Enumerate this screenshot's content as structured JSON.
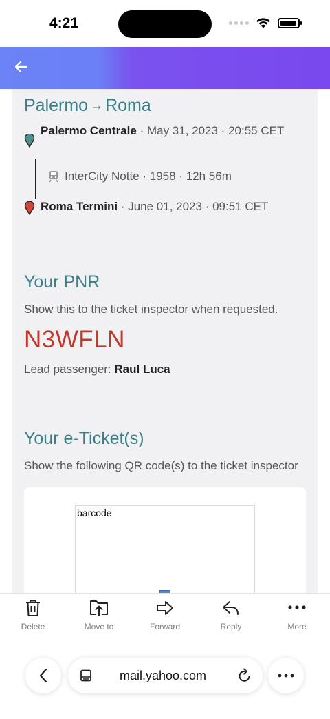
{
  "status_bar": {
    "time": "4:21"
  },
  "trip": {
    "origin_city": "Palermo",
    "arrow": "→",
    "destination_city": "Roma",
    "departure": {
      "station": "Palermo Centrale",
      "details": " · May 31, 2023 · 20:55 CET"
    },
    "train": {
      "service": "InterCity Notte",
      "number": "1958",
      "duration": "12h 56m",
      "sep": " · "
    },
    "arrival": {
      "station": "Roma Termini",
      "details": " · June 01, 2023 · 09:51 CET"
    }
  },
  "pnr": {
    "heading": "Your PNR",
    "instruction": "Show this to the ticket inspector when requested.",
    "code": "N3WFLN",
    "lead_label": "Lead passenger: ",
    "lead_name": "Raul Luca"
  },
  "eticket": {
    "heading": "Your e-Ticket(s)",
    "instruction": "Show the following QR code(s) to the ticket inspector",
    "barcode_alt": "barcode"
  },
  "toolbar": {
    "delete": "Delete",
    "move_to": "Move to",
    "forward": "Forward",
    "reply": "Reply",
    "more": "More"
  },
  "browser": {
    "url": "mail.yahoo.com"
  },
  "colors": {
    "heading_teal": "#3b8089",
    "pnr_red": "#c0392b",
    "header_blue": "#6b83f7",
    "header_purple": "#7a48ee",
    "pin_teal": "#4f8d8e",
    "pin_red": "#d2433a"
  }
}
